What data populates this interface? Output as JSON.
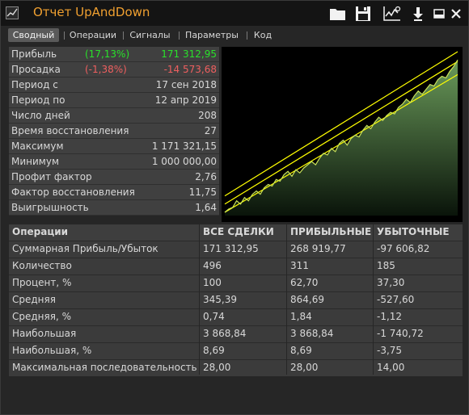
{
  "window": {
    "title": "Отчет UpAndDown"
  },
  "toolbar": {
    "icons": [
      "folder-icon",
      "save-icon",
      "chart-settings-icon",
      "download-icon",
      "minimize-icon",
      "close-icon"
    ]
  },
  "tabs": [
    {
      "label": "Сводный",
      "active": true
    },
    {
      "label": "Операции",
      "active": false
    },
    {
      "label": "Сигналы",
      "active": false
    },
    {
      "label": "Параметры",
      "active": false
    },
    {
      "label": "Код",
      "active": false
    }
  ],
  "stats": [
    {
      "label": "Прибыль",
      "pct": "(17,13%)",
      "value": "171 312,95",
      "color": "#29e12a"
    },
    {
      "label": "Просадка",
      "pct": "(-1,38%)",
      "value": "-14 573,68",
      "color": "#ef5f5f"
    },
    {
      "label": "Период с",
      "pct": "",
      "value": "17 сен 2018",
      "color": ""
    },
    {
      "label": "Период по",
      "pct": "",
      "value": "12 апр 2019",
      "color": ""
    },
    {
      "label": "Число дней",
      "pct": "",
      "value": "208",
      "color": ""
    },
    {
      "label": "Время восстановления",
      "pct": "",
      "value": "27",
      "color": ""
    },
    {
      "label": "Максимум",
      "pct": "",
      "value": "1 171 321,15",
      "color": ""
    },
    {
      "label": "Минимум",
      "pct": "",
      "value": "1 000 000,00",
      "color": ""
    },
    {
      "label": "Профит фактор",
      "pct": "",
      "value": "2,76",
      "color": ""
    },
    {
      "label": "Фактор восстановления",
      "pct": "",
      "value": "11,75",
      "color": ""
    },
    {
      "label": "Выигрышность",
      "pct": "",
      "value": "1,64",
      "color": ""
    }
  ],
  "operations": {
    "headers": [
      "Операции",
      "ВСЕ СДЕЛКИ",
      "ПРИБЫЛЬНЫЕ",
      "УБЫТОЧНЫЕ"
    ],
    "rows": [
      [
        "Суммарная Прибыль/Убыток",
        "171 312,95",
        "268 919,77",
        "-97 606,82"
      ],
      [
        "Количество",
        "496",
        "311",
        "185"
      ],
      [
        "Процент, %",
        "100",
        "62,70",
        "37,30"
      ],
      [
        "Средняя",
        "345,39",
        "864,69",
        "-527,60"
      ],
      [
        "Средняя, %",
        "0,74",
        "1,84",
        "-1,12"
      ],
      [
        "Наибольшая",
        "3 868,84",
        "3 868,84",
        "-1 740,72"
      ],
      [
        "Наибольшая, %",
        "8,69",
        "8,69",
        "-3,75"
      ],
      [
        "Максимальная последовательность",
        "28,00",
        "28,00",
        "14,00"
      ]
    ]
  },
  "chart_data": {
    "type": "area",
    "x_range": [
      0,
      100
    ],
    "y_range": [
      0,
      100
    ],
    "series": [
      {
        "values": [
          2,
          4,
          5,
          9,
          7,
          11,
          9,
          13,
          15,
          13,
          17,
          19,
          18,
          22,
          21,
          25,
          27,
          24,
          28,
          26,
          29,
          31,
          33,
          31,
          35,
          38,
          37,
          41,
          39,
          44,
          46,
          43,
          47,
          49,
          48,
          52,
          55,
          53,
          57,
          60,
          58,
          61,
          63,
          62,
          66,
          68,
          71,
          69,
          73,
          76,
          74,
          77,
          80,
          79,
          83,
          85,
          84,
          88,
          91,
          95
        ]
      }
    ],
    "channel": {
      "lower": [
        2,
        86
      ],
      "mid": [
        7,
        94
      ],
      "upper": [
        12,
        100
      ]
    },
    "colors": {
      "line": "#c8e25a",
      "channel": "#ffff00",
      "fill_top": "#6a9a5a",
      "fill_bottom": "#000000"
    }
  }
}
